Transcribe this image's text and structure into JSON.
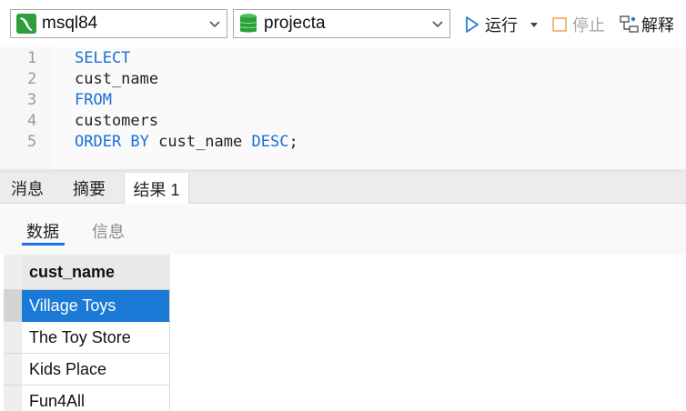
{
  "toolbar": {
    "connection": "msql84",
    "database": "projecta",
    "run_label": "运行",
    "stop_label": "停止",
    "explain_label": "解释"
  },
  "editor": {
    "lines": [
      {
        "num": "1",
        "tokens": [
          {
            "t": "SELECT",
            "k": "kw"
          }
        ]
      },
      {
        "num": "2",
        "tokens": [
          {
            "t": "cust_name",
            "k": "id"
          }
        ]
      },
      {
        "num": "3",
        "tokens": [
          {
            "t": "FROM",
            "k": "kw"
          }
        ]
      },
      {
        "num": "4",
        "tokens": [
          {
            "t": "customers",
            "k": "id"
          }
        ]
      },
      {
        "num": "5",
        "tokens": [
          {
            "t": "ORDER BY",
            "k": "kw"
          },
          {
            "t": " cust_name ",
            "k": "id"
          },
          {
            "t": "DESC",
            "k": "kw"
          },
          {
            "t": ";",
            "k": "id"
          }
        ]
      }
    ]
  },
  "result_tabs": [
    "消息",
    "摘要",
    "结果 1"
  ],
  "active_result_tab": "结果 1",
  "sub_tabs": [
    "数据",
    "信息"
  ],
  "active_sub_tab": "数据",
  "grid": {
    "columns": [
      "cust_name"
    ],
    "rows": [
      [
        "Village Toys"
      ],
      [
        "The Toy Store"
      ],
      [
        "Kids Place"
      ],
      [
        "Fun4All"
      ]
    ],
    "selected_row": 0
  },
  "colors": {
    "keyword": "#1a6fd6",
    "selection": "#1b7ad6",
    "run_icon": "#2a7be0",
    "stop_icon": "#f0a050",
    "db_icon": "#2e9e3a",
    "conn_icon": "#2e9e3a"
  },
  "icons": {
    "connection": "mysql-dolphin-icon",
    "database": "database-cylinder-icon",
    "run": "play-icon",
    "stop": "stop-square-icon",
    "explain": "explain-tree-icon",
    "dropdown": "chevron-down-icon"
  }
}
